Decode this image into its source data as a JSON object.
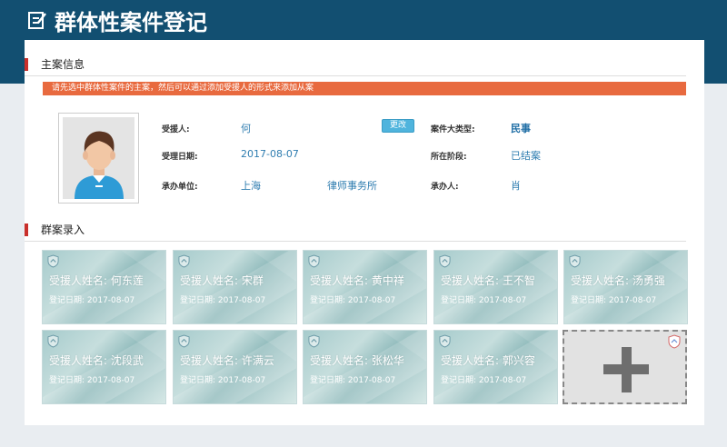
{
  "header": {
    "title": "群体性案件登记",
    "icon": "edit-icon"
  },
  "main_case": {
    "section_title": "主案信息",
    "notice": "请先选中群体性案件的主案，然后可以通过添加受援人的形式来添加从案",
    "recipient_label": "受援人:",
    "recipient_value": "何",
    "change_button": "更改",
    "accept_date_label": "受理日期:",
    "accept_date_value": "2017-08-07",
    "unit_label": "承办单位:",
    "unit_city": "上海",
    "unit_firm": "律师事务所",
    "case_type_label": "案件大类型:",
    "case_type_value": "民事",
    "stage_label": "所在阶段:",
    "stage_value": "已结案",
    "handler_label": "承办人:",
    "handler_value": "肖"
  },
  "group_cases": {
    "section_title": "群案录入",
    "name_prefix": "受援人姓名:",
    "date_prefix": "登记日期:",
    "cards": [
      {
        "name": "受援人姓名: 何东莲",
        "date": "登记日期: 2017-08-07"
      },
      {
        "name": "受援人姓名: 宋群",
        "date": "登记日期: 2017-08-07"
      },
      {
        "name": "受援人姓名: 黄中祥",
        "date": "登记日期: 2017-08-07"
      },
      {
        "name": "受援人姓名: 王不智",
        "date": "登记日期: 2017-08-07"
      },
      {
        "name": "受援人姓名: 汤勇强",
        "date": "登记日期: 2017-08-07"
      },
      {
        "name": "受援人姓名: 沈段武",
        "date": "登记日期: 2017-08-07"
      },
      {
        "name": "受援人姓名: 许满云",
        "date": "登记日期: 2017-08-07"
      },
      {
        "name": "受援人姓名: 张松华",
        "date": "登记日期: 2017-08-07"
      },
      {
        "name": "受援人姓名: 郭兴容",
        "date": "登记日期: 2017-08-07"
      }
    ],
    "add_icon": "plus-icon"
  },
  "colors": {
    "header_bg": "#124f71",
    "notice_bg": "#e86a3f",
    "accent_red": "#c9302c",
    "link_blue": "#2f7db0"
  }
}
